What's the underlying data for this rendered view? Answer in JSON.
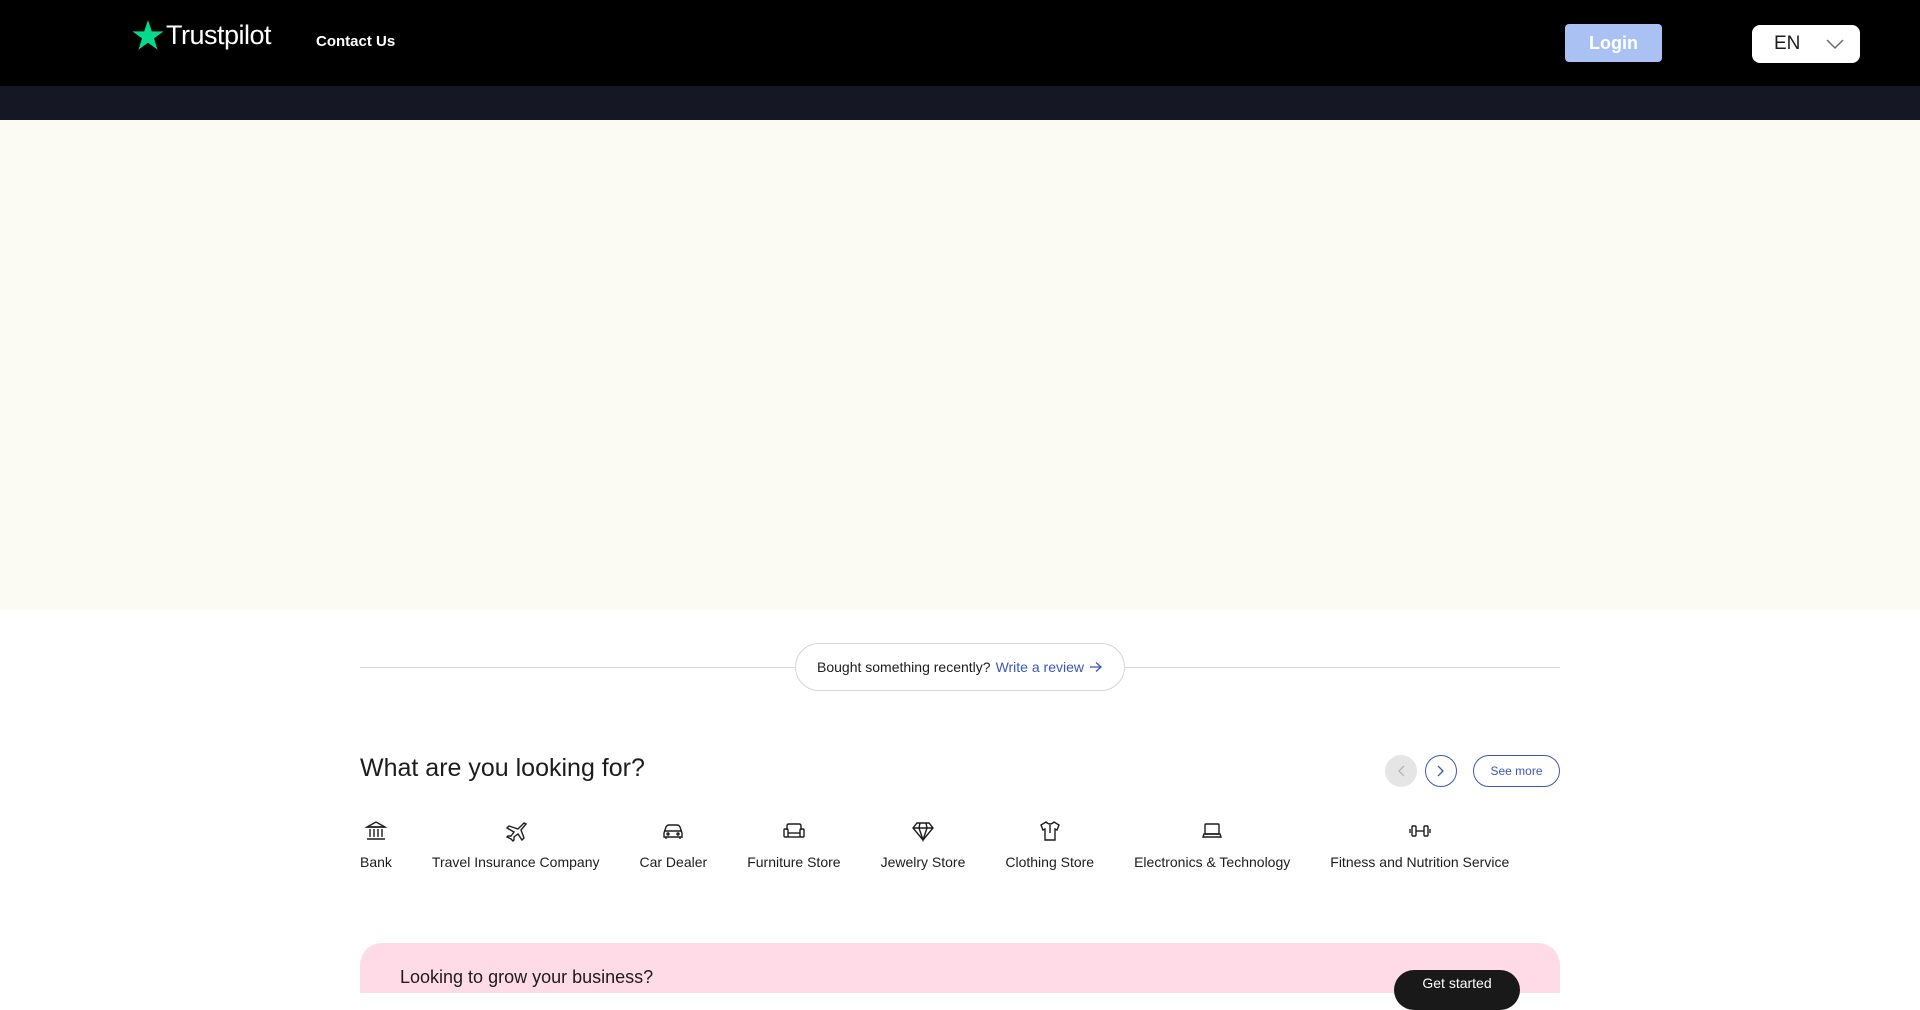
{
  "header": {
    "brand": "Trustpilot",
    "contact_label": "Contact Us",
    "login_label": "Login",
    "language": "EN",
    "colors": {
      "background": "#000000",
      "star": "#04da8d",
      "login": "#a9c2f3"
    }
  },
  "review_prompt": {
    "text": "Bought something recently?",
    "link": "Write a review"
  },
  "categories": {
    "title": "What are you looking for?",
    "see_more": "See more",
    "items": [
      {
        "label": "Bank",
        "icon": "bank-icon"
      },
      {
        "label": "Travel Insurance Company",
        "icon": "airplane-icon"
      },
      {
        "label": "Car Dealer",
        "icon": "car-icon"
      },
      {
        "label": "Furniture Store",
        "icon": "sofa-icon"
      },
      {
        "label": "Jewelry Store",
        "icon": "diamond-icon"
      },
      {
        "label": "Clothing Store",
        "icon": "shirt-icon"
      },
      {
        "label": "Electronics & Technology",
        "icon": "laptop-icon"
      },
      {
        "label": "Fitness and Nutrition Service",
        "icon": "dumbbell-icon"
      }
    ]
  },
  "promo": {
    "title": "Looking to grow your business?",
    "button": "Get started",
    "color": "#ffdae7"
  }
}
